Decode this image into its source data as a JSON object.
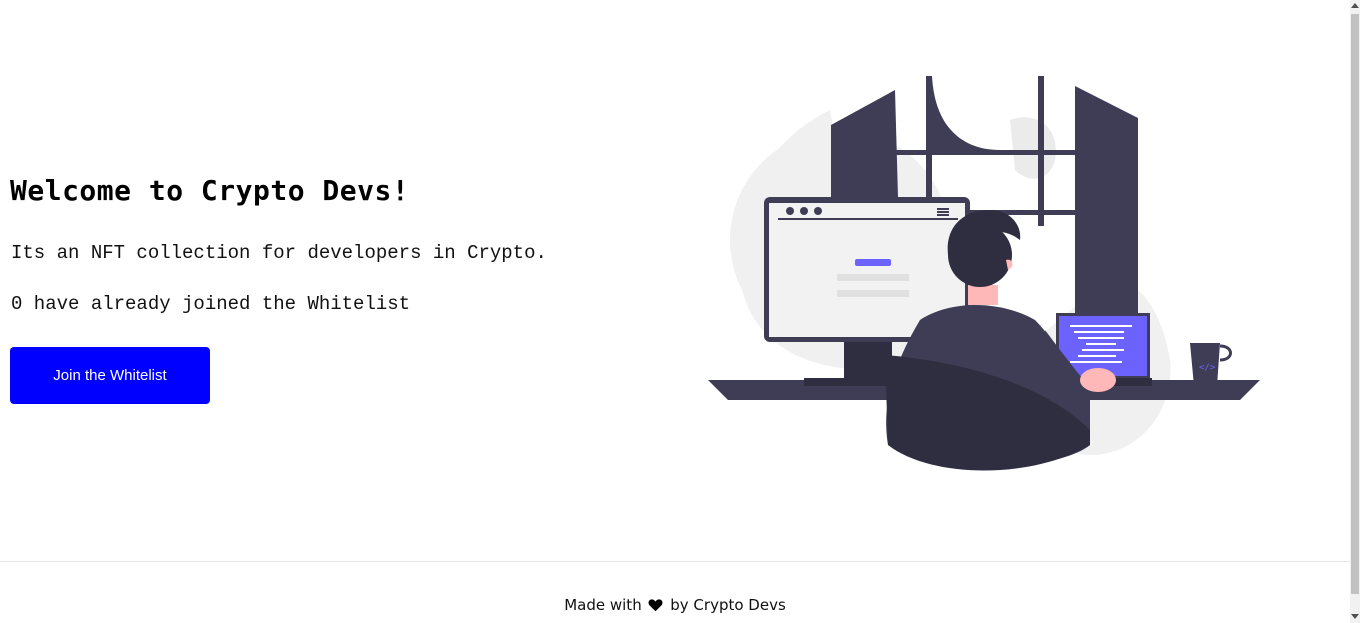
{
  "main": {
    "title": "Welcome to Crypto Devs!",
    "description": "Its an NFT collection for developers in Crypto.",
    "whitelist_status": "0 have already joined the Whitelist",
    "join_button_label": "Join the Whitelist"
  },
  "illustration": {
    "name": "developer-at-desk-illustration"
  },
  "footer": {
    "prefix": "Made with",
    "heart_icon": "heart-icon",
    "suffix": "by Crypto Devs"
  },
  "colors": {
    "button": "#0000ff",
    "accent": "#6c63ff",
    "dark": "#3f3d56"
  }
}
